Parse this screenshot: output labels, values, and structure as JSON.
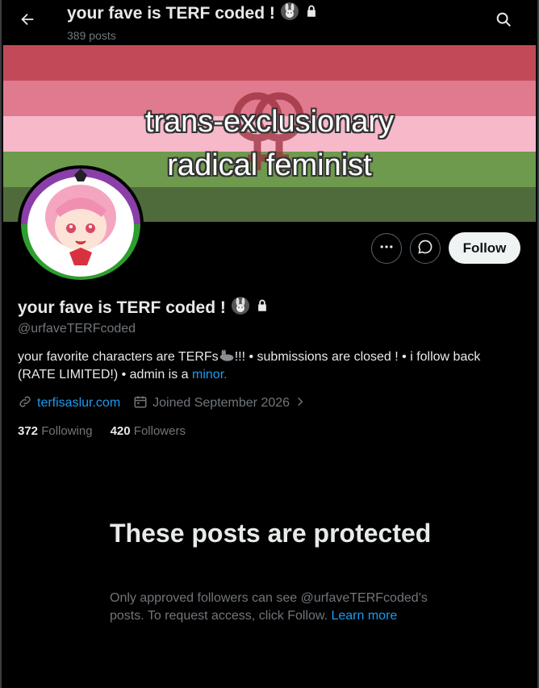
{
  "header": {
    "title": "your fave is TERF coded !",
    "post_count": "389 posts"
  },
  "banner": {
    "line1": "trans-exclusionary",
    "line2": "radical feminist",
    "stripe_colors": [
      "#c24a58",
      "#e07a8e",
      "#f7b8ca",
      "#6d9a4d",
      "#4f6b3b"
    ]
  },
  "actions": {
    "follow_label": "Follow"
  },
  "profile": {
    "name": "your fave is TERF coded !",
    "handle": "@urfaveTERFcoded",
    "bio_part1": "your favorite characters are TERFs",
    "bio_part2": "!!! • submissions are closed ! • i follow back (RATE LIMITED!) • admin is a ",
    "bio_link": "minor.",
    "website": "terfisaslur.com",
    "joined": "Joined September 2026",
    "following_count": "372",
    "following_label": "Following",
    "followers_count": "420",
    "followers_label": "Followers"
  },
  "protected": {
    "title": "These posts are protected",
    "description": "Only approved followers can see @urfaveTERFcoded’s posts. To request access, click Follow. ",
    "learn_more": "Learn more"
  },
  "colors": {
    "accent": "#1d9bf0",
    "background": "#000000",
    "muted": "#71767b"
  },
  "icons": [
    "back-arrow-icon",
    "search-icon",
    "rabbit-emoji-icon",
    "lock-icon",
    "more-icon",
    "message-icon",
    "link-icon",
    "calendar-icon",
    "chevron-right-icon"
  ]
}
